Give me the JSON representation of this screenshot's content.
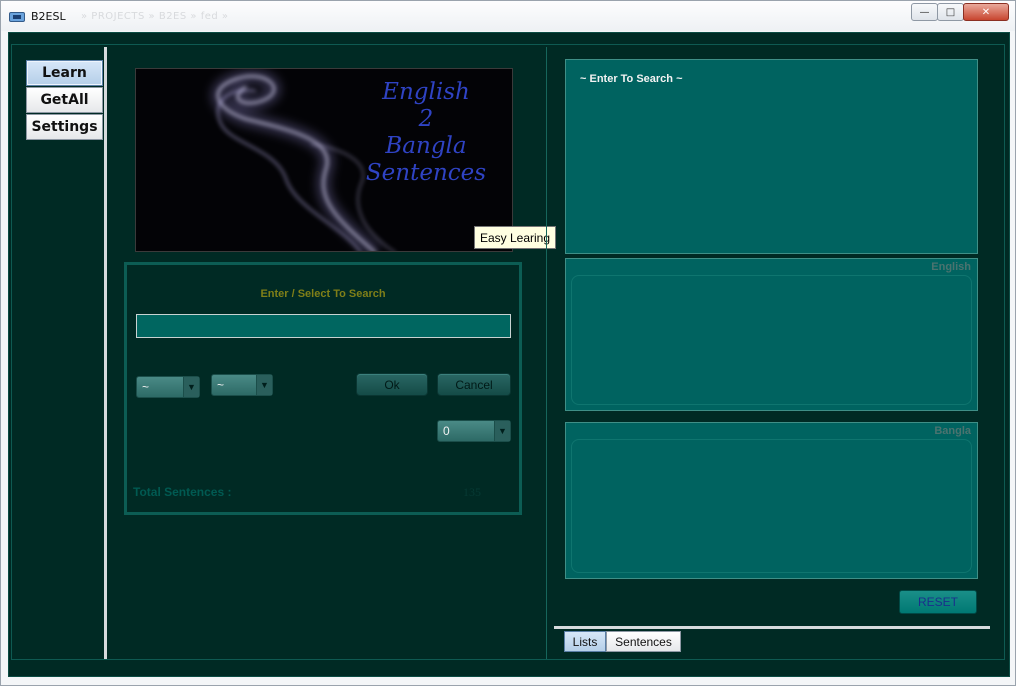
{
  "window": {
    "title": "B2ESL",
    "faded_path": "» PROJECTS » B2ES » fed »",
    "minimize": "—",
    "maximize": "□",
    "close": "✕"
  },
  "sidebar": {
    "tabs": [
      {
        "label": "Learn",
        "active": true
      },
      {
        "label": "GetAll",
        "active": false
      },
      {
        "label": "Settings",
        "active": false
      }
    ]
  },
  "banner": {
    "lines": [
      "English",
      "2",
      "Bangla",
      "Sentences"
    ],
    "tooltip": "Easy Learing"
  },
  "search": {
    "label": "Enter / Select To Search",
    "value": "",
    "combo1": "~",
    "combo2": "~",
    "ok_label": "Ok",
    "cancel_label": "Cancel",
    "combo3": "0",
    "total_label": "Total Sentences :",
    "total_value": "135"
  },
  "right": {
    "search_hint": "~ Enter To Search ~",
    "english_title": "English",
    "bangla_title": "Bangla",
    "reset_label": "RESET",
    "bottom_tabs": [
      {
        "label": "Lists",
        "active": true
      },
      {
        "label": "Sentences",
        "active": false
      }
    ]
  },
  "colors": {
    "background": "#002a24",
    "panel": "#006360",
    "accent_text": "#7f7f18",
    "banner_text": "#2f43c4"
  }
}
